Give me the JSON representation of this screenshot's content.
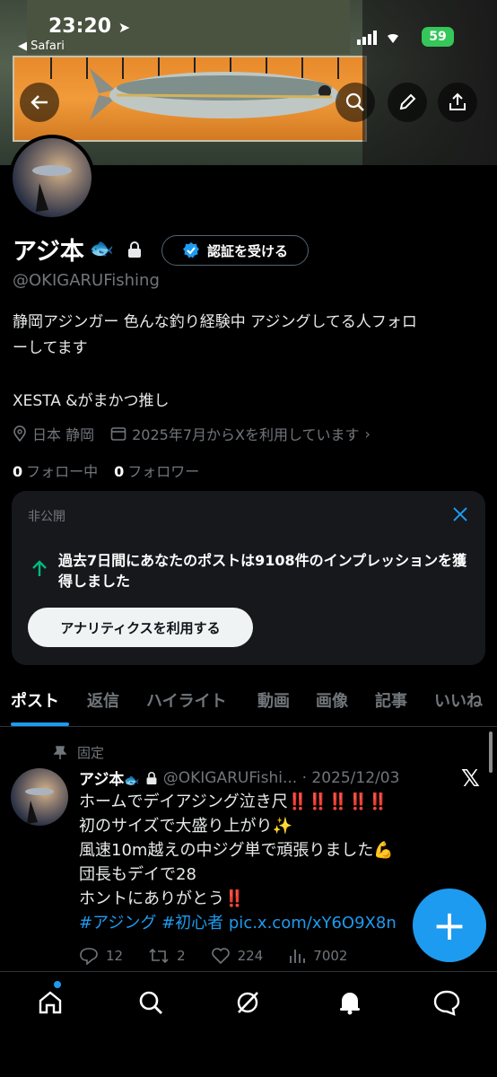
{
  "status_bar": {
    "time": "23:20",
    "back_app": "Safari",
    "battery": "59"
  },
  "profile": {
    "name": "アジ本",
    "name_emoji": "🐟",
    "verify_button": "認証を受ける",
    "handle": "@OKIGARUFishing",
    "bio_line1": "静岡アジンガー 色んな釣り経験中 アジングしてる人フォロ",
    "bio_line2": "ーしてます",
    "bio_line3": "XESTA &がまかつ推し",
    "location": "日本 静岡",
    "joined": "2025年7月からXを利用しています",
    "following_count": "0",
    "following_label": "フォロー中",
    "followers_count": "0",
    "followers_label": "フォロワー"
  },
  "analytics_card": {
    "label": "非公開",
    "message": "過去7日間にあなたのポストは9108件のインプレッションを獲得しました",
    "button": "アナリティクスを利用する"
  },
  "tabs": [
    "ポスト",
    "返信",
    "ハイライト",
    "動画",
    "画像",
    "記事",
    "いいね"
  ],
  "post": {
    "pinned_label": "固定",
    "author": "アジ本",
    "author_emoji": "🐟",
    "handle_date": "@OKIGARUFishi... · 2025/12/03",
    "lines": [
      "ホームでデイアジング泣き尺‼️‼️‼️‼️‼️",
      "初のサイズで大盛り上がり✨",
      "風速10m越えの中ジグ単で頑張りました💪",
      "団長もデイで28",
      "ホントにありがとう‼️"
    ],
    "hashtags": "#アジング #初心者 pic.x.com/xY6O9X8n",
    "replies": "12",
    "reposts": "2",
    "likes": "224",
    "views": "7002"
  },
  "fab_label": "+",
  "colors": {
    "accent": "#1d9bf0",
    "background": "#000000",
    "muted": "#71767b"
  }
}
